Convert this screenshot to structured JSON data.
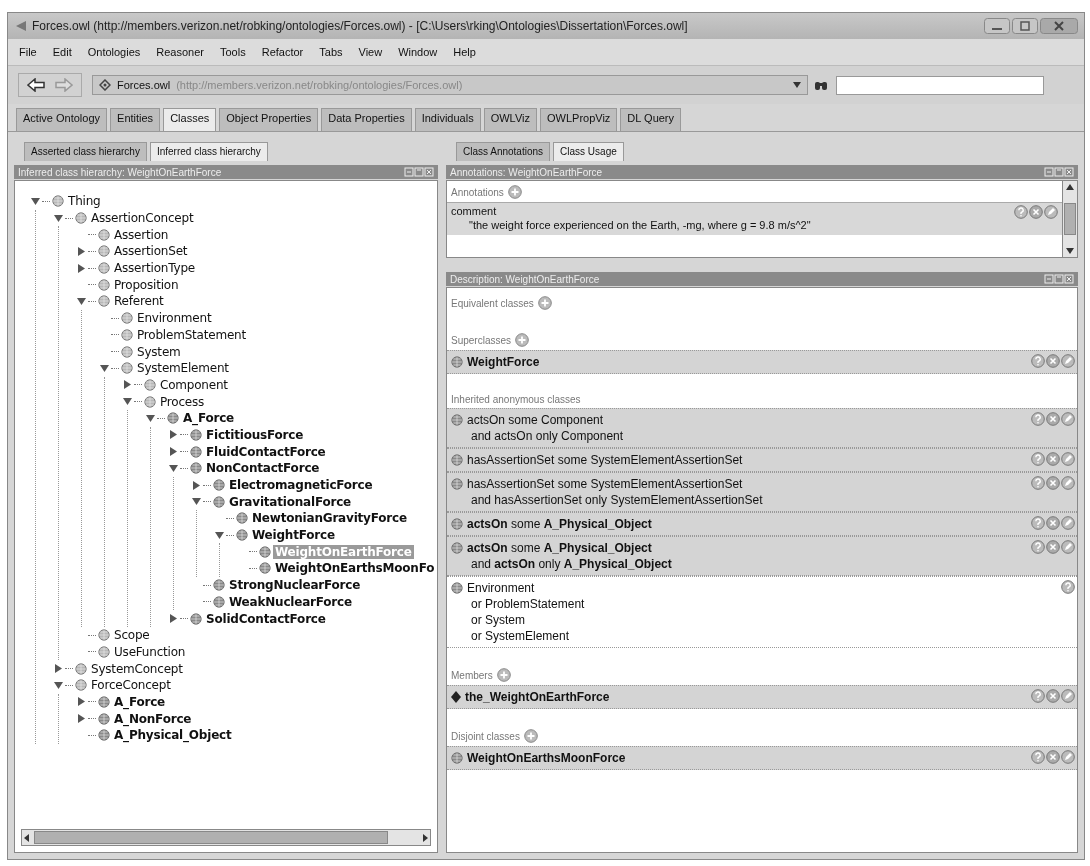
{
  "window": {
    "title": "Forces.owl (http://members.verizon.net/robking/ontologies/Forces.owl) - [C:\\Users\\rking\\Ontologies\\Dissertation\\Forces.owl]"
  },
  "menu": [
    "File",
    "Edit",
    "Ontologies",
    "Reasoner",
    "Tools",
    "Refactor",
    "Tabs",
    "View",
    "Window",
    "Help"
  ],
  "toolbar": {
    "ontology_name": "Forces.owl",
    "ontology_uri": "(http://members.verizon.net/robking/ontologies/Forces.owl)"
  },
  "tabs": [
    {
      "label": "Active Ontology",
      "selected": false
    },
    {
      "label": "Entities",
      "selected": false
    },
    {
      "label": "Classes",
      "selected": true
    },
    {
      "label": "Object Properties",
      "selected": false
    },
    {
      "label": "Data Properties",
      "selected": false
    },
    {
      "label": "Individuals",
      "selected": false
    },
    {
      "label": "OWLViz",
      "selected": false
    },
    {
      "label": "OWLPropViz",
      "selected": false
    },
    {
      "label": "DL Query",
      "selected": false
    }
  ],
  "left": {
    "tabs": [
      {
        "label": "Asserted class hierarchy",
        "selected": false
      },
      {
        "label": "Inferred class hierarchy",
        "selected": true
      }
    ],
    "title": "Inferred class hierarchy: WeightOnEarthForce",
    "tree": [
      {
        "label": "Thing",
        "kind": "branch",
        "expanded": true,
        "bold": false,
        "selected": false,
        "children": [
          {
            "label": "AssertionConcept",
            "kind": "branch",
            "expanded": true,
            "bold": false,
            "selected": false,
            "children": [
              {
                "label": "Assertion",
                "kind": "leaf",
                "bold": false,
                "selected": false
              },
              {
                "label": "AssertionSet",
                "kind": "branch",
                "expanded": false,
                "bold": false,
                "selected": false
              },
              {
                "label": "AssertionType",
                "kind": "branch",
                "expanded": false,
                "bold": false,
                "selected": false
              },
              {
                "label": "Proposition",
                "kind": "leaf",
                "bold": false,
                "selected": false
              },
              {
                "label": "Referent",
                "kind": "branch",
                "expanded": true,
                "bold": false,
                "selected": false,
                "children": [
                  {
                    "label": "Environment",
                    "kind": "leaf",
                    "bold": false,
                    "selected": false
                  },
                  {
                    "label": "ProblemStatement",
                    "kind": "leaf",
                    "bold": false,
                    "selected": false
                  },
                  {
                    "label": "System",
                    "kind": "leaf",
                    "bold": false,
                    "selected": false
                  },
                  {
                    "label": "SystemElement",
                    "kind": "branch",
                    "expanded": true,
                    "bold": false,
                    "selected": false,
                    "children": [
                      {
                        "label": "Component",
                        "kind": "branch",
                        "expanded": false,
                        "bold": false,
                        "selected": false
                      },
                      {
                        "label": "Process",
                        "kind": "branch",
                        "expanded": true,
                        "bold": false,
                        "selected": false,
                        "children": [
                          {
                            "label": "A_Force",
                            "kind": "branch",
                            "expanded": true,
                            "bold": true,
                            "selected": false,
                            "children": [
                              {
                                "label": "FictitiousForce",
                                "kind": "branch",
                                "expanded": false,
                                "bold": true,
                                "selected": false
                              },
                              {
                                "label": "FluidContactForce",
                                "kind": "branch",
                                "expanded": false,
                                "bold": true,
                                "selected": false
                              },
                              {
                                "label": "NonContactForce",
                                "kind": "branch",
                                "expanded": true,
                                "bold": true,
                                "selected": false,
                                "children": [
                                  {
                                    "label": "ElectromagneticForce",
                                    "kind": "branch",
                                    "expanded": false,
                                    "bold": true,
                                    "selected": false
                                  },
                                  {
                                    "label": "GravitationalForce",
                                    "kind": "branch",
                                    "expanded": true,
                                    "bold": true,
                                    "selected": false,
                                    "children": [
                                      {
                                        "label": "NewtonianGravityForce",
                                        "kind": "leaf",
                                        "bold": true,
                                        "selected": false
                                      },
                                      {
                                        "label": "WeightForce",
                                        "kind": "branch",
                                        "expanded": true,
                                        "bold": true,
                                        "selected": false,
                                        "children": [
                                          {
                                            "label": "WeightOnEarthForce",
                                            "kind": "leaf",
                                            "bold": true,
                                            "selected": true
                                          },
                                          {
                                            "label": "WeightOnEarthsMoonFo",
                                            "kind": "leaf",
                                            "bold": true,
                                            "selected": false
                                          }
                                        ]
                                      }
                                    ]
                                  },
                                  {
                                    "label": "StrongNuclearForce",
                                    "kind": "leaf",
                                    "bold": true,
                                    "selected": false
                                  },
                                  {
                                    "label": "WeakNuclearForce",
                                    "kind": "leaf",
                                    "bold": true,
                                    "selected": false
                                  }
                                ]
                              },
                              {
                                "label": "SolidContactForce",
                                "kind": "branch",
                                "expanded": false,
                                "bold": true,
                                "selected": false
                              }
                            ]
                          }
                        ]
                      }
                    ]
                  }
                ]
              },
              {
                "label": "Scope",
                "kind": "leaf",
                "bold": false,
                "selected": false
              },
              {
                "label": "UseFunction",
                "kind": "leaf",
                "bold": false,
                "selected": false
              }
            ]
          },
          {
            "label": "SystemConcept",
            "kind": "branch",
            "expanded": false,
            "bold": false,
            "selected": false
          },
          {
            "label": "ForceConcept",
            "kind": "branch",
            "expanded": true,
            "bold": false,
            "selected": false,
            "children": [
              {
                "label": "A_Force",
                "kind": "branch",
                "expanded": false,
                "bold": true,
                "selected": false
              },
              {
                "label": "A_NonForce",
                "kind": "branch",
                "expanded": false,
                "bold": true,
                "selected": false
              },
              {
                "label": "A_Physical_Object",
                "kind": "leaf",
                "bold": true,
                "selected": false
              }
            ]
          }
        ]
      }
    ]
  },
  "right": {
    "tabs": [
      {
        "label": "Class Annotations",
        "selected": false
      },
      {
        "label": "Class Usage",
        "selected": true
      }
    ],
    "annotations": {
      "title": "Annotations: WeightOnEarthForce",
      "heading": "Annotations",
      "items": [
        {
          "property": "comment",
          "value": "\"the weight force experienced on the Earth, -mg, where g = 9.8 m/s^2\""
        }
      ]
    },
    "description": {
      "title": "Description: WeightOnEarthForce",
      "sections": [
        {
          "heading": "Equivalent classes",
          "addable": true
        },
        {
          "heading": "Superclasses",
          "addable": true,
          "rows": [
            {
              "kind": "class",
              "shaded": true,
              "editable": true,
              "lines": [
                "**WeightForce**"
              ]
            }
          ]
        },
        {
          "heading": "Inherited anonymous classes",
          "addable": false,
          "rows": [
            {
              "kind": "class",
              "shaded": true,
              "editable": true,
              "lines": [
                "actsOn some Component",
                "and actsOn only Component"
              ]
            },
            {
              "kind": "class",
              "shaded": true,
              "editable": true,
              "lines": [
                "hasAssertionSet some SystemElementAssertionSet"
              ]
            },
            {
              "kind": "class",
              "shaded": true,
              "editable": true,
              "lines": [
                "hasAssertionSet some SystemElementAssertionSet",
                "and hasAssertionSet only SystemElementAssertionSet"
              ]
            },
            {
              "kind": "class",
              "shaded": true,
              "editable": true,
              "lines": [
                "**actsOn** some **A_Physical_Object**"
              ]
            },
            {
              "kind": "class",
              "shaded": true,
              "editable": true,
              "lines": [
                "**actsOn** some **A_Physical_Object**",
                "and **actsOn** only **A_Physical_Object**"
              ]
            },
            {
              "kind": "class",
              "shaded": false,
              "editable": false,
              "lines": [
                "Environment",
                "or ProblemStatement",
                "or System",
                "or SystemElement"
              ]
            }
          ]
        },
        {
          "heading": "Members",
          "addable": true,
          "rows": [
            {
              "kind": "individual",
              "shaded": true,
              "editable": true,
              "lines": [
                "**the_WeightOnEarthForce**"
              ]
            }
          ]
        },
        {
          "heading": "Disjoint classes",
          "addable": true,
          "rows": [
            {
              "kind": "class",
              "shaded": true,
              "editable": true,
              "lines": [
                "**WeightOnEarthsMoonForce**"
              ]
            }
          ]
        }
      ]
    }
  }
}
